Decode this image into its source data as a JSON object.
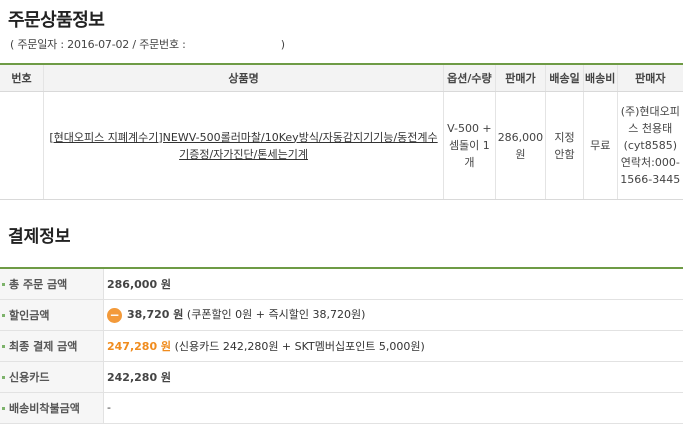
{
  "order": {
    "title": "주문상품정보",
    "meta_prefix": "( 주문일자 : 2016-07-02 / 주문번호 :",
    "meta_suffix": ")"
  },
  "items_table": {
    "headers": [
      "번호",
      "상품명",
      "옵션/수량",
      "판매가",
      "배송일",
      "배송비",
      "판매자"
    ],
    "rows": [
      {
        "no": "",
        "name": "[현대오피스 지폐계수기]NEWV-500롤러마찰/10Key방식/자동감지기기능/동전계수기증정/자가진단/톤세는기계",
        "option": "V-500 + 셈돌이 1개",
        "price": "286,000 원",
        "delivery": "지정 안함",
        "shipping": "무료",
        "seller": "(주)현대오피스 천용태 (cyt8585) 연락처:000-1566-3445"
      }
    ]
  },
  "payment": {
    "title": "결제정보",
    "rows": [
      {
        "label": "총 주문 금액",
        "amount": "286,000 원",
        "detail": ""
      },
      {
        "label": "할인금액",
        "icon": "−",
        "amount": "38,720 원",
        "detail": "(쿠폰할인 0원 + 즉시할인 38,720원)"
      },
      {
        "label": "최종 결제 금액",
        "amount": "247,280 원",
        "detail": "(신용카드 242,280원 + SKT멤버십포인트 5,000원)"
      },
      {
        "label": "신용카드",
        "amount": "242,280 원",
        "detail": ""
      },
      {
        "label": "배송비착불금액",
        "amount": "-",
        "detail": ""
      }
    ]
  },
  "colors": {
    "accent_green": "#6e9b45",
    "orange": "#f08c1e"
  }
}
